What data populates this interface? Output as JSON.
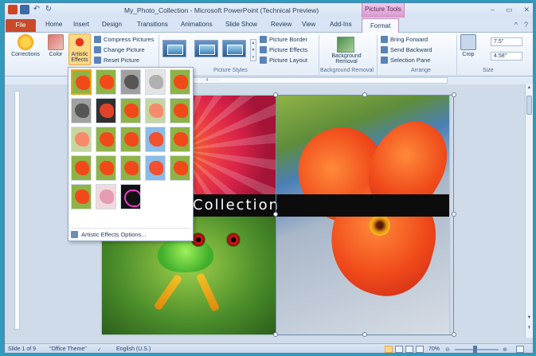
{
  "window": {
    "title": "My_Photo_Collection  -  Microsoft PowerPoint (Technical Preview)",
    "contextual_tab_group": "Picture Tools",
    "controls": [
      "–",
      "▭",
      "✕"
    ]
  },
  "tabs": {
    "file": "File",
    "items": [
      "Home",
      "Insert",
      "Design",
      "Transitions",
      "Animations",
      "Slide Show",
      "Review",
      "View",
      "Add-Ins"
    ],
    "active": "Format"
  },
  "ribbon": {
    "adjust": {
      "corrections": "Corrections",
      "color": "Color",
      "artistic_effects": "Artistic Effects",
      "compress": "Compress Pictures",
      "change": "Change Picture",
      "reset": "Reset Picture"
    },
    "picture_styles": {
      "group_label": "Picture Styles",
      "border": "Picture Border",
      "effects": "Picture Effects",
      "layout": "Picture Layout"
    },
    "background_removal": {
      "button": "Background Removal",
      "group_label": "Background Removal"
    },
    "arrange": {
      "group_label": "Arrange",
      "bring_forward": "Bring Forward",
      "send_backward": "Send Backward",
      "selection_pane": "Selection Pane"
    },
    "size": {
      "group_label": "Size",
      "crop": "Crop",
      "height": "7.5\"",
      "width": "4.58\""
    }
  },
  "ruler_text": "· · 2 · · · · · · 1 · · · · · · 0 · · · · · · 1 · · · · · · 2 · · · · · · 3 · · · · · · 4 · · ·",
  "slide": {
    "title": "Collection"
  },
  "gallery": {
    "option": "Artistic Effects Options..."
  },
  "statusbar": {
    "slide_info": "Slide 1 of 9",
    "theme": "\"Office Theme\"",
    "language": "English (U.S.)",
    "zoom": "70%"
  }
}
